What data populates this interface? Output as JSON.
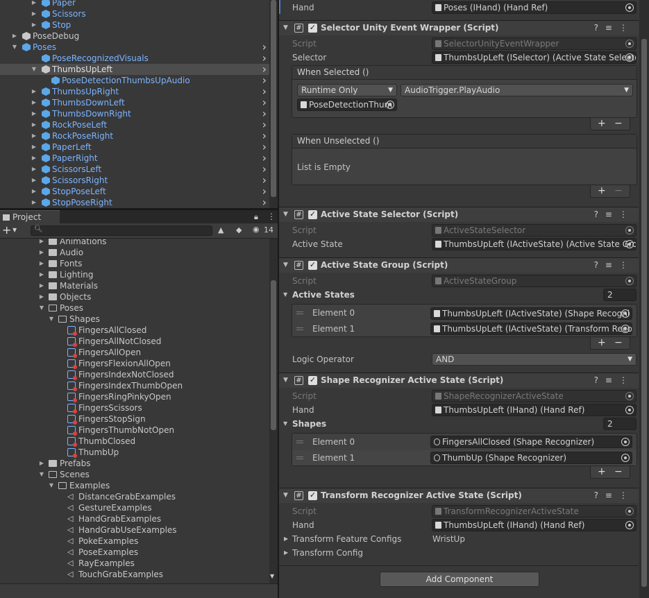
{
  "hierarchy": {
    "items": [
      {
        "label": "Paper",
        "blue": true
      },
      {
        "label": "Scissors",
        "blue": true
      },
      {
        "label": "Stop",
        "blue": true
      },
      {
        "label": "PoseDebug",
        "blue": false
      },
      {
        "label": "Poses",
        "blue": true
      },
      {
        "label": "PoseRecognizedVisuals",
        "blue": true
      },
      {
        "label": "ThumbsUpLeft",
        "blue": false
      },
      {
        "label": "PoseDetectionThumbsUpAudio",
        "blue": true
      },
      {
        "label": "ThumbsUpRight",
        "blue": true
      },
      {
        "label": "ThumbsDownLeft",
        "blue": true
      },
      {
        "label": "ThumbsDownRight",
        "blue": true
      },
      {
        "label": "RockPoseLeft",
        "blue": true
      },
      {
        "label": "RockPoseRight",
        "blue": true
      },
      {
        "label": "PaperLeft",
        "blue": true
      },
      {
        "label": "PaperRight",
        "blue": true
      },
      {
        "label": "ScissorsLeft",
        "blue": true
      },
      {
        "label": "ScissorsRight",
        "blue": true
      },
      {
        "label": "StopPoseLeft",
        "blue": true
      },
      {
        "label": "StopPoseRight",
        "blue": true
      }
    ]
  },
  "project": {
    "tab_label": "Project",
    "hidden_count": "14",
    "items": [
      {
        "label": "Animations",
        "type": "folder"
      },
      {
        "label": "Audio",
        "type": "folder"
      },
      {
        "label": "Fonts",
        "type": "folder"
      },
      {
        "label": "Lighting",
        "type": "folder"
      },
      {
        "label": "Materials",
        "type": "folder"
      },
      {
        "label": "Objects",
        "type": "folder"
      },
      {
        "label": "Poses",
        "type": "folder-open"
      },
      {
        "label": "Shapes",
        "type": "folder-open"
      },
      {
        "label": "FingersAllClosed",
        "type": "asset"
      },
      {
        "label": "FingersAllNotClosed",
        "type": "asset"
      },
      {
        "label": "FingersAllOpen",
        "type": "asset"
      },
      {
        "label": "FingersFlexionAllOpen",
        "type": "asset"
      },
      {
        "label": "FingersIndexNotClosed",
        "type": "asset"
      },
      {
        "label": "FingersIndexThumbOpen",
        "type": "asset"
      },
      {
        "label": "FingersRingPinkyOpen",
        "type": "asset"
      },
      {
        "label": "FingersScissors",
        "type": "asset"
      },
      {
        "label": "FingersStopSign",
        "type": "asset"
      },
      {
        "label": "FingersThumbNotOpen",
        "type": "asset"
      },
      {
        "label": "ThumbClosed",
        "type": "asset"
      },
      {
        "label": "ThumbUp",
        "type": "asset"
      },
      {
        "label": "Prefabs",
        "type": "folder"
      },
      {
        "label": "Scenes",
        "type": "folder-open"
      },
      {
        "label": "Examples",
        "type": "folder-open"
      },
      {
        "label": "DistanceGrabExamples",
        "type": "scene"
      },
      {
        "label": "GestureExamples",
        "type": "scene"
      },
      {
        "label": "HandGrabExamples",
        "type": "scene"
      },
      {
        "label": "HandGrabUseExamples",
        "type": "scene"
      },
      {
        "label": "PokeExamples",
        "type": "scene"
      },
      {
        "label": "PoseExamples",
        "type": "scene"
      },
      {
        "label": "RayExamples",
        "type": "scene"
      },
      {
        "label": "TouchGrabExamples",
        "type": "scene"
      }
    ]
  },
  "inspector": {
    "top_hand": {
      "label": "Hand",
      "value": "Poses (IHand) (Hand Ref)"
    },
    "selector_wrapper": {
      "title": "Selector Unity Event Wrapper (Script)",
      "script_label": "Script",
      "script_value": "SelectorUnityEventWrapper",
      "selector_label": "Selector",
      "selector_value": "ThumbsUpLeft (ISelector) (Active State Selecto",
      "when_selected": "When Selected ()",
      "runtime": "Runtime Only",
      "function": "AudioTrigger.PlayAudio",
      "target": "PoseDetectionThum",
      "when_unselected": "When Unselected ()",
      "empty": "List is Empty",
      "plus": "+",
      "minus": "−"
    },
    "active_state_selector": {
      "title": "Active State Selector (Script)",
      "script_label": "Script",
      "script_value": "ActiveStateSelector",
      "state_label": "Active State",
      "state_value": "ThumbsUpLeft (IActiveState) (Active State Gro"
    },
    "active_state_group": {
      "title": "Active State Group (Script)",
      "script_label": "Script",
      "script_value": "ActiveStateGroup",
      "states_label": "Active States",
      "count": "2",
      "elements": [
        {
          "label": "Element 0",
          "value": "ThumbsUpLeft (IActiveState) (Shape Recogni"
        },
        {
          "label": "Element 1",
          "value": "ThumbsUpLeft (IActiveState) (Transform Reco"
        }
      ],
      "logic_label": "Logic Operator",
      "logic_value": "AND"
    },
    "shape_recognizer": {
      "title": "Shape Recognizer Active State (Script)",
      "script_label": "Script",
      "script_value": "ShapeRecognizerActiveState",
      "hand_label": "Hand",
      "hand_value": "ThumbsUpLeft (IHand) (Hand Ref)",
      "shapes_label": "Shapes",
      "count": "2",
      "elements": [
        {
          "label": "Element 0",
          "value": "FingersAllClosed (Shape Recognizer)"
        },
        {
          "label": "Element 1",
          "value": "ThumbUp (Shape Recognizer)"
        }
      ]
    },
    "transform_recognizer": {
      "title": "Transform Recognizer Active State (Script)",
      "script_label": "Script",
      "script_value": "TransformRecognizerActiveState",
      "hand_label": "Hand",
      "hand_value": "ThumbsUpLeft (IHand) (Hand Ref)",
      "feature_label": "Transform Feature Configs",
      "feature_value": "WristUp",
      "config_label": "Transform Config"
    },
    "add_component": "Add Component"
  }
}
